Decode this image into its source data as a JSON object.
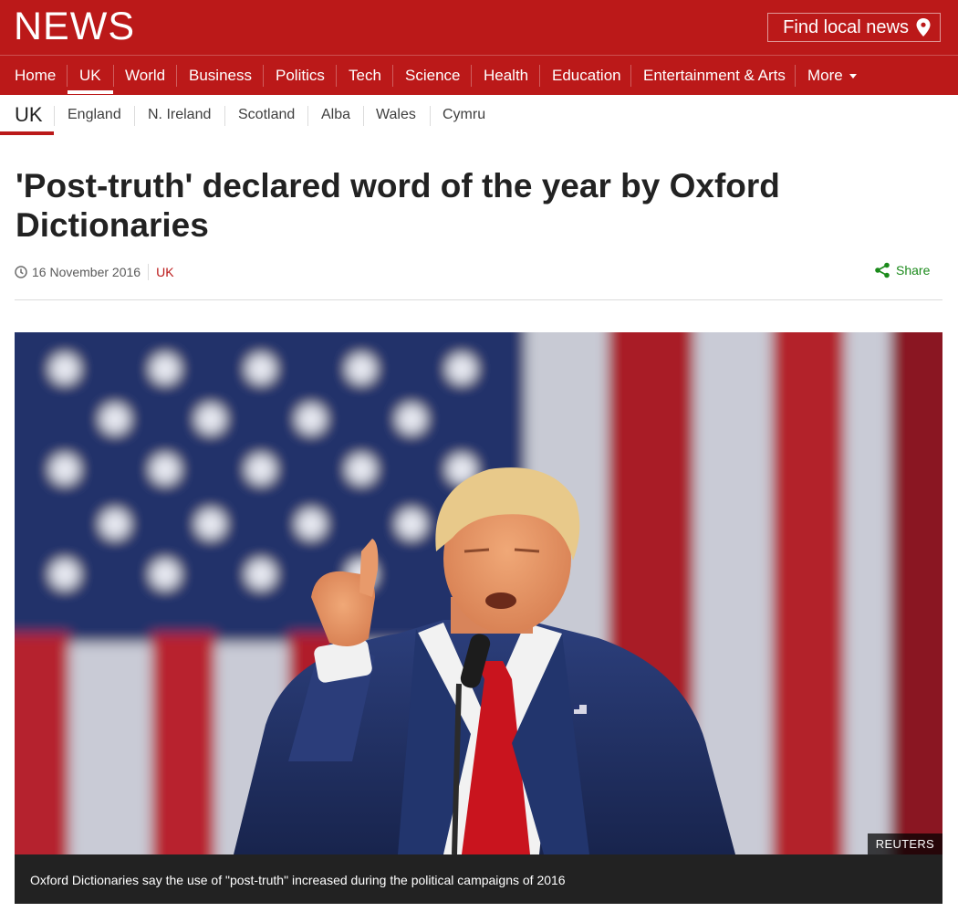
{
  "brand": {
    "logo_text": "NEWS",
    "color": "#bb1919"
  },
  "header": {
    "local_news_label": "Find local news",
    "local_icon": "location-pin-icon"
  },
  "nav": {
    "items": [
      {
        "label": "Home"
      },
      {
        "label": "UK",
        "active": true
      },
      {
        "label": "World"
      },
      {
        "label": "Business"
      },
      {
        "label": "Politics"
      },
      {
        "label": "Tech"
      },
      {
        "label": "Science"
      },
      {
        "label": "Health"
      },
      {
        "label": "Education"
      },
      {
        "label": "Entertainment & Arts"
      },
      {
        "label": "More"
      }
    ]
  },
  "subnav": {
    "section": "UK",
    "items": [
      {
        "label": "England"
      },
      {
        "label": "N. Ireland"
      },
      {
        "label": "Scotland"
      },
      {
        "label": "Alba"
      },
      {
        "label": "Wales"
      },
      {
        "label": "Cymru"
      }
    ]
  },
  "article": {
    "headline": "'Post-truth' declared word of the year by Oxford Dictionaries",
    "date": "16 November 2016",
    "section": "UK",
    "share_label": "Share"
  },
  "figure": {
    "credit": "REUTERS",
    "caption": "Oxford Dictionaries say the use of \"post-truth\" increased during the political campaigns of 2016"
  },
  "colors": {
    "share_green": "#1b8a1b",
    "caption_bg": "#222222"
  }
}
